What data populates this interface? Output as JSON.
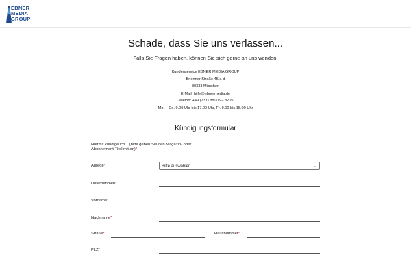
{
  "logo": {
    "line1": "EBNER",
    "line2": "MEDIA",
    "line3": "GROUP",
    "colors": {
      "brand": "#1e4a8c",
      "accent": "#5aa8d6"
    }
  },
  "title": "Schade, dass Sie uns verlassen...",
  "subtitle": "Falls Sie Fragen haben, können Sie sich gerne an uns wenden:",
  "contact": [
    "Kundenservice EBNER MEDIA GROUP",
    "Brienner Straße 45 a-d",
    "80333 München",
    "E-Mail: hilfe@ebnermedia.de",
    "Telefon: +49 (731) 88005 – 8205",
    "Mo. – Do. 9.00 Uhr bis 17.00 Uhr, Fr. 9.00 bis 15.00 Uhr"
  ],
  "form": {
    "title": "Kündigungsformular",
    "magazine_label": "Hiermit kündige ich... (bitte geben Sie den Magazin- oder Abonnement-Titel mit an)",
    "anrede_label": "Anrede",
    "anrede_value": "Bitte auswählen",
    "unternehmen_label": "Unternehmen",
    "vorname_label": "Vorname",
    "nachname_label": "Nachname",
    "strasse_label": "Straße",
    "hausnummer_label": "Hausnummer",
    "plz_label": "PLZ",
    "required_mark": "*"
  }
}
